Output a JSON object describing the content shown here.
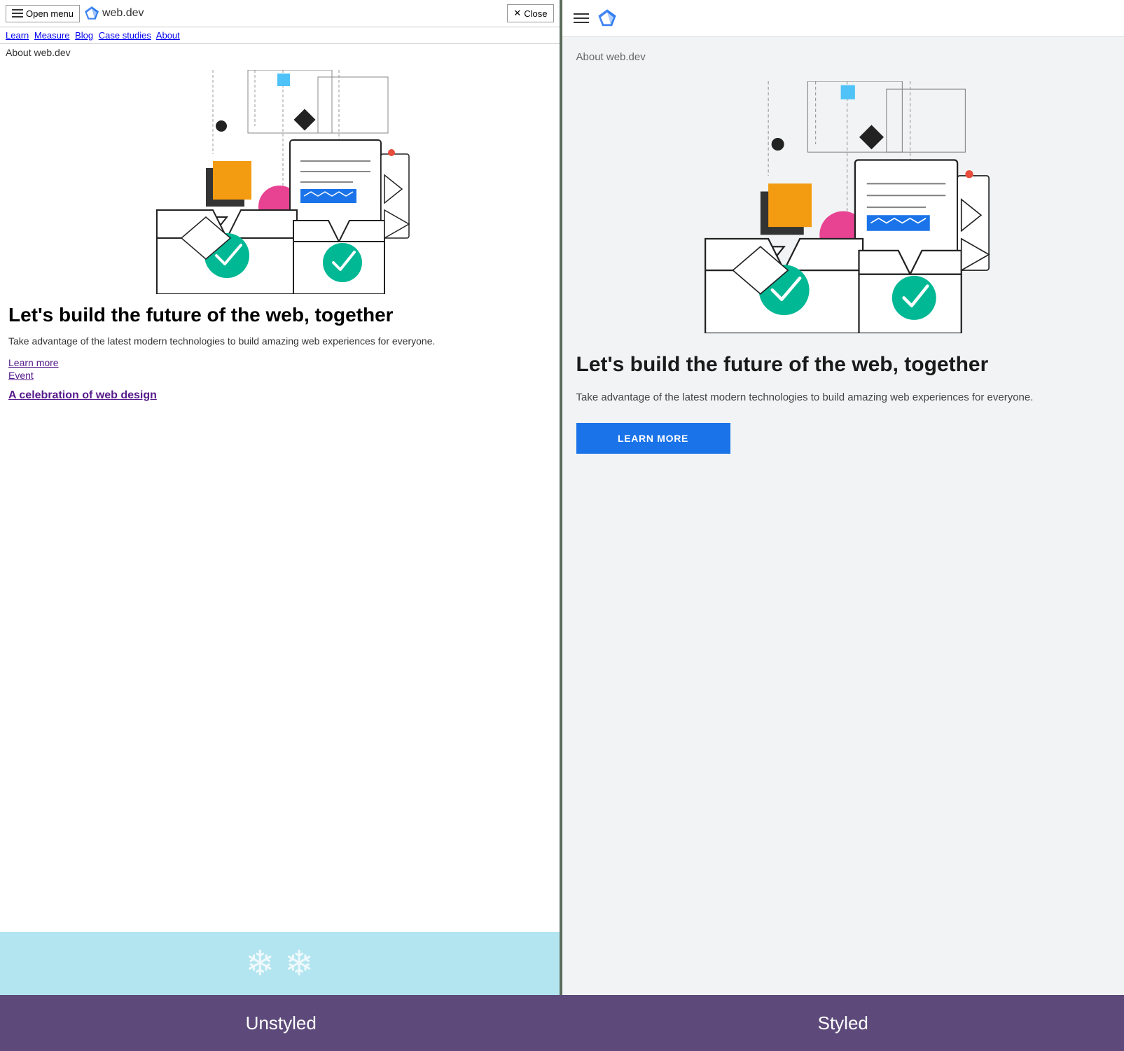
{
  "left": {
    "menu_button": "Open menu",
    "logo_text": "web.dev",
    "close_button": "Close",
    "nav_links": [
      "Learn",
      "Measure",
      "Blog",
      "Case studies",
      "About"
    ],
    "about_label": "About web.dev",
    "hero_heading": "Let's build the future of the web, together",
    "hero_desc": "Take advantage of the latest modern technologies to build amazing web experiences for everyone.",
    "link_learn_more": "Learn more",
    "link_event": "Event",
    "link_celebration": "A celebration of web design",
    "label": "Unstyled"
  },
  "right": {
    "about_label": "About web.dev",
    "hero_heading": "Let's build the future of the web, together",
    "hero_desc": "Take advantage of the latest modern technologies to build amazing web experiences for everyone.",
    "learn_more_btn": "LEARN MORE",
    "label": "Styled"
  },
  "colors": {
    "accent_blue": "#1a73e8",
    "accent_purple": "#551a8b",
    "label_bg": "#5d4a7a",
    "teal_check": "#00b894",
    "orange_box": "#f39c12",
    "pink_circle": "#e84393",
    "blue_bar": "#1a73e8",
    "blue_square": "#4fc3f7",
    "dark_diamond": "#222"
  }
}
